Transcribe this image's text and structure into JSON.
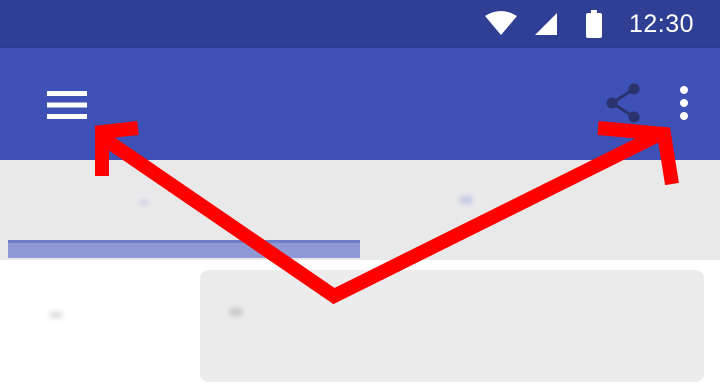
{
  "status_bar": {
    "time": "12:30",
    "icons": [
      "wifi-icon",
      "cellular-signal-icon",
      "battery-icon"
    ]
  },
  "app_bar": {
    "menu_icon": "hamburger-menu-icon",
    "actions": [
      "share-icon",
      "more-vert-icon"
    ]
  },
  "tabs": [
    {
      "label": "",
      "selected": true
    },
    {
      "label": "",
      "selected": false
    }
  ],
  "content": {
    "left_label": "",
    "input_value": ""
  },
  "annotation": {
    "description": "",
    "color": "#ff0000"
  },
  "colors": {
    "status_bar": "#2f3f94",
    "app_bar": "#3d51b6",
    "tab_strip": "#e9e9ea",
    "indicator": "#8f99d6",
    "annotation_arrow": "#ff0000"
  }
}
